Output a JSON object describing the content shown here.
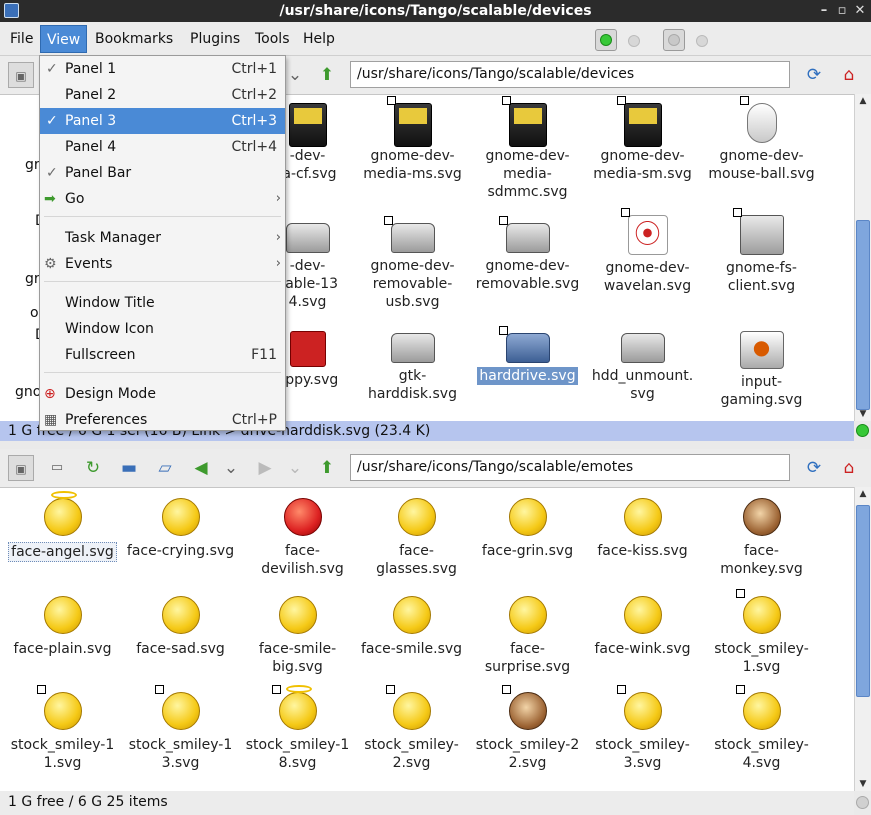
{
  "window": {
    "title": "/usr/share/icons/Tango/scalable/devices",
    "controls": [
      "–",
      "▫",
      "✕"
    ]
  },
  "menubar": {
    "items": [
      "File",
      "View",
      "Bookmarks",
      "Plugins",
      "Tools",
      "Help"
    ]
  },
  "view_menu": {
    "items": [
      {
        "label": "Panel 1",
        "accel": "Ctrl+1",
        "checked": "✓"
      },
      {
        "label": "Panel 2",
        "accel": "Ctrl+2",
        "checked": ""
      },
      {
        "label": "Panel 3",
        "accel": "Ctrl+3",
        "checked": "✓"
      },
      {
        "label": "Panel 4",
        "accel": "Ctrl+4",
        "checked": ""
      },
      {
        "label": "Panel Bar",
        "accel": "",
        "checked": "✓"
      },
      {
        "label": "Go",
        "accel": "",
        "checked": ""
      },
      {
        "label": "Task Manager",
        "accel": "",
        "checked": ""
      },
      {
        "label": "Events",
        "accel": "",
        "checked": ""
      },
      {
        "label": "Window Title",
        "accel": "",
        "checked": ""
      },
      {
        "label": "Window Icon",
        "accel": "",
        "checked": ""
      },
      {
        "label": "Fullscreen",
        "accel": "F11",
        "checked": ""
      },
      {
        "label": "Design Mode",
        "accel": "",
        "checked": ""
      },
      {
        "label": "Preferences",
        "accel": "Ctrl+P",
        "checked": ""
      }
    ]
  },
  "panel_top": {
    "path": "/usr/share/icons/Tango/scalable/devices",
    "status": "1 G free / 6 G   1 sel (16 B)   Link > drive-harddisk.svg (23.4 K)",
    "left_fragments": [
      "gr",
      "D",
      "gr",
      "o",
      "D",
      "gno"
    ],
    "items": [
      "gnome-dev-media-cf.svg",
      "gnome-dev-media-ms.svg",
      "gnome-dev-media-sdmmc.svg",
      "gnome-dev-media-sm.svg",
      "gnome-dev-mouse-ball.svg",
      "gnome-dev-removable-1394.svg",
      "gnome-dev-removable-usb.svg",
      "gnome-dev-removable.svg",
      "gnome-dev-wavelan.svg",
      "gnome-fs-client.svg",
      "floppy.svg",
      "gtk-harddisk.svg",
      "harddrive.svg",
      "hdd_unmount.svg",
      "input-gaming.svg"
    ],
    "visible_labels": [
      "-dev-\nia-cf.svg",
      "gnome-dev-\nmedia-ms.svg",
      "gnome-dev-\nmedia-\nsdmmc.svg",
      "gnome-dev-\nmedia-sm.svg",
      "gnome-dev-\nmouse-ball.svg",
      "-dev-\nvable-13\n4.svg",
      "gnome-dev-\nremovable-\nusb.svg",
      "gnome-dev-\nremovable.svg",
      "gnome-dev-\nwavelan.svg",
      "gnome-fs-\nclient.svg",
      "oppy.svg",
      "gtk-\nharddisk.svg",
      "harddrive.svg",
      "hdd_unmount.\nsvg",
      "input-\ngaming.svg"
    ]
  },
  "panel_bottom": {
    "path": "/usr/share/icons/Tango/scalable/emotes",
    "status": "1 G free / 6 G   25 items",
    "items": [
      "face-angel.svg",
      "face-crying.svg",
      "face-\ndevilish.svg",
      "face-\nglasses.svg",
      "face-grin.svg",
      "face-kiss.svg",
      "face-\nmonkey.svg",
      "face-plain.svg",
      "face-sad.svg",
      "face-smile-\nbig.svg",
      "face-smile.svg",
      "face-\nsurprise.svg",
      "face-wink.svg",
      "stock_smiley-\n1.svg",
      "stock_smiley-1\n1.svg",
      "stock_smiley-1\n3.svg",
      "stock_smiley-1\n8.svg",
      "stock_smiley-\n2.svg",
      "stock_smiley-2\n2.svg",
      "stock_smiley-\n3.svg",
      "stock_smiley-\n4.svg"
    ]
  },
  "colors": {
    "selection": "#6e95c9",
    "menu_highlight": "#4a8ad6",
    "status_active": "#b6c5ee",
    "led_on": "#37c837"
  }
}
